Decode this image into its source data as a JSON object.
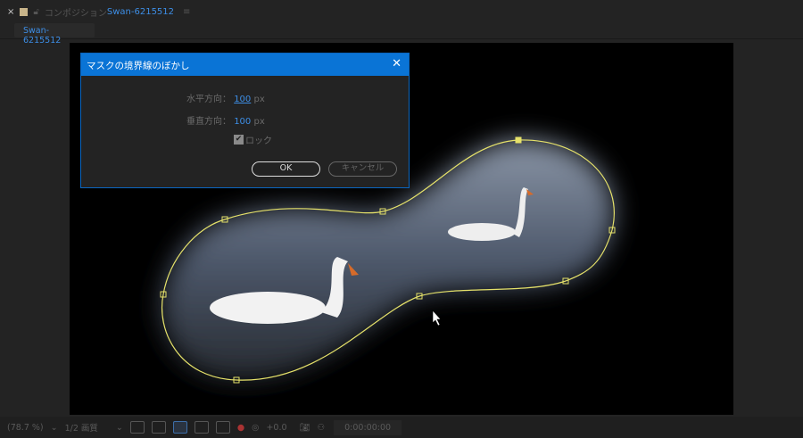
{
  "header": {
    "close": "×",
    "label": "コンポジション",
    "comp_name": "Swan-6215512",
    "menu": "≡"
  },
  "tab": {
    "label": "Swan-6215512"
  },
  "dialog": {
    "title": "マスクの境界線のぼかし",
    "close": "✕",
    "horizontal_label": "水平方向：",
    "horizontal_value": "100",
    "vertical_label": "垂直方向：",
    "vertical_value": "100",
    "unit": "px",
    "lock_label": "ロック",
    "lock_checked": true,
    "ok": "OK",
    "cancel": "キャンセル"
  },
  "footer": {
    "zoom": "(78.7 %)",
    "quality": "1/2 画質",
    "exposure": "+0.0",
    "timecode": "0:00:00:00"
  },
  "colors": {
    "accent": "#0a74d6",
    "mask": "#e6e26a"
  }
}
